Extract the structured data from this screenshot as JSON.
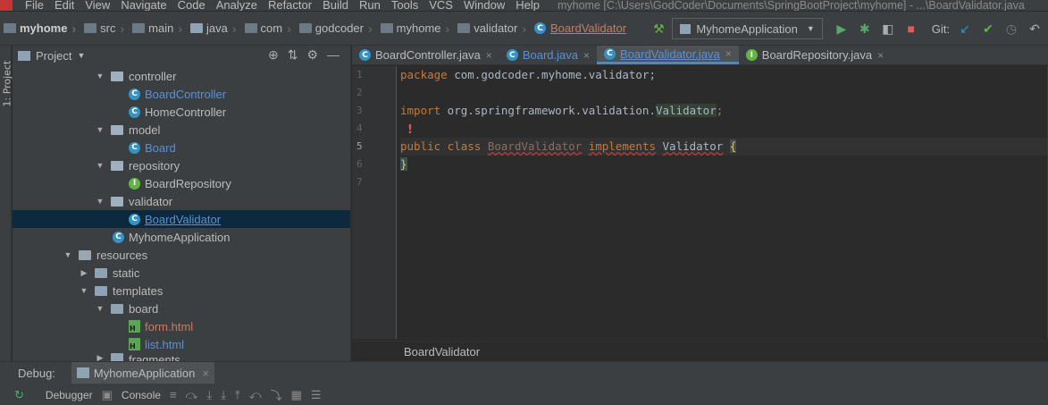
{
  "menubar": {
    "items": [
      "File",
      "Edit",
      "View",
      "Navigate",
      "Code",
      "Analyze",
      "Refactor",
      "Build",
      "Run",
      "Tools",
      "VCS",
      "Window",
      "Help"
    ],
    "window_title": "myhome [C:\\Users\\GodCoder\\Documents\\SpringBootProject\\myhome] - ...\\BoardValidator.java"
  },
  "breadcrumb": {
    "items": [
      "myhome",
      "src",
      "main",
      "java",
      "com",
      "godcoder",
      "myhome",
      "validator",
      "BoardValidator"
    ]
  },
  "toolbar": {
    "run_config": "MyhomeApplication",
    "git_label": "Git:"
  },
  "project_panel": {
    "title": "Project",
    "side_label": "1: Project",
    "tree": [
      {
        "label": "controller",
        "type": "package",
        "expanded": true
      },
      {
        "label": "BoardController",
        "type": "class"
      },
      {
        "label": "HomeController",
        "type": "class"
      },
      {
        "label": "model",
        "type": "package",
        "expanded": true
      },
      {
        "label": "Board",
        "type": "class"
      },
      {
        "label": "repository",
        "type": "package",
        "expanded": true
      },
      {
        "label": "BoardRepository",
        "type": "interface"
      },
      {
        "label": "validator",
        "type": "package",
        "expanded": true
      },
      {
        "label": "BoardValidator",
        "type": "class",
        "selected": true
      },
      {
        "label": "MyhomeApplication",
        "type": "class"
      },
      {
        "label": "resources",
        "type": "folder",
        "expanded": true
      },
      {
        "label": "static",
        "type": "folder",
        "expanded": false
      },
      {
        "label": "templates",
        "type": "folder",
        "expanded": true
      },
      {
        "label": "board",
        "type": "folder",
        "expanded": true
      },
      {
        "label": "form.html",
        "type": "html"
      },
      {
        "label": "list.html",
        "type": "html"
      },
      {
        "label": "fragments",
        "type": "folder",
        "expanded": false
      }
    ]
  },
  "editor": {
    "tabs": [
      {
        "label": "BoardController.java",
        "icon": "class"
      },
      {
        "label": "Board.java",
        "icon": "class"
      },
      {
        "label": "BoardValidator.java",
        "icon": "class",
        "active": true
      },
      {
        "label": "BoardRepository.java",
        "icon": "interface"
      }
    ],
    "line_numbers": [
      "1",
      "2",
      "3",
      "4",
      "5",
      "6",
      "7"
    ],
    "code": {
      "l1_kw": "package",
      "l1_rest": " com.godcoder.myhome.validator;",
      "l3_kw": "import",
      "l3_rest": " org.springframework.validation.",
      "l3_cls": "Validator",
      "l3_end": ";",
      "l5_kw1": "public class",
      "l5_name": "BoardValidator",
      "l5_kw2": "implements",
      "l5_iface": "Validator",
      "l5_brace": "{",
      "l6_brace": "}"
    },
    "sticky_label": "BoardValidator"
  },
  "debug_panel": {
    "label": "Debug:",
    "session": "MyhomeApplication",
    "tools": [
      "Debugger",
      "Console"
    ]
  },
  "colors": {
    "accent": "#4a88c7",
    "keyword": "#cc7832",
    "class_icon": "#3592c4",
    "interface_icon": "#62b543",
    "selection": "#0d293e"
  }
}
